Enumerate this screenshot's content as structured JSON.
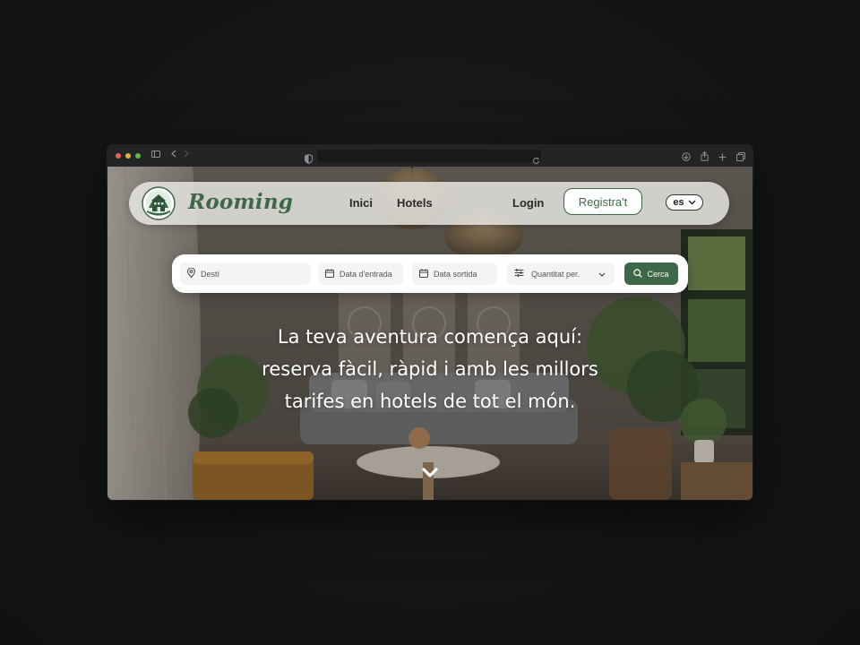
{
  "browser": {
    "controls": [
      "close",
      "minimize",
      "maximize"
    ],
    "colors": {
      "close": "#ec5f57",
      "minimize": "#e4b23c",
      "maximize": "#5cb84f"
    }
  },
  "navbar": {
    "brand": "Rooming",
    "links": {
      "home": "Inici",
      "hotels": "Hotels",
      "login": "Login"
    },
    "register_label": "Registra't",
    "language": "es"
  },
  "search": {
    "destination_placeholder": "Destí",
    "checkin_placeholder": "Data d'entrada",
    "checkout_placeholder": "Data sortida",
    "guests_placeholder": "Quantitat per.",
    "button_label": "Cerca"
  },
  "hero": {
    "headline_line1": "La teva aventura comença aquí:",
    "headline_line2": "reserva fàcil, ràpid i amb les millors",
    "headline_line3": "tarifes en hotels de tot el món."
  },
  "colors": {
    "accent": "#3f6849",
    "page_background": "#141516"
  }
}
